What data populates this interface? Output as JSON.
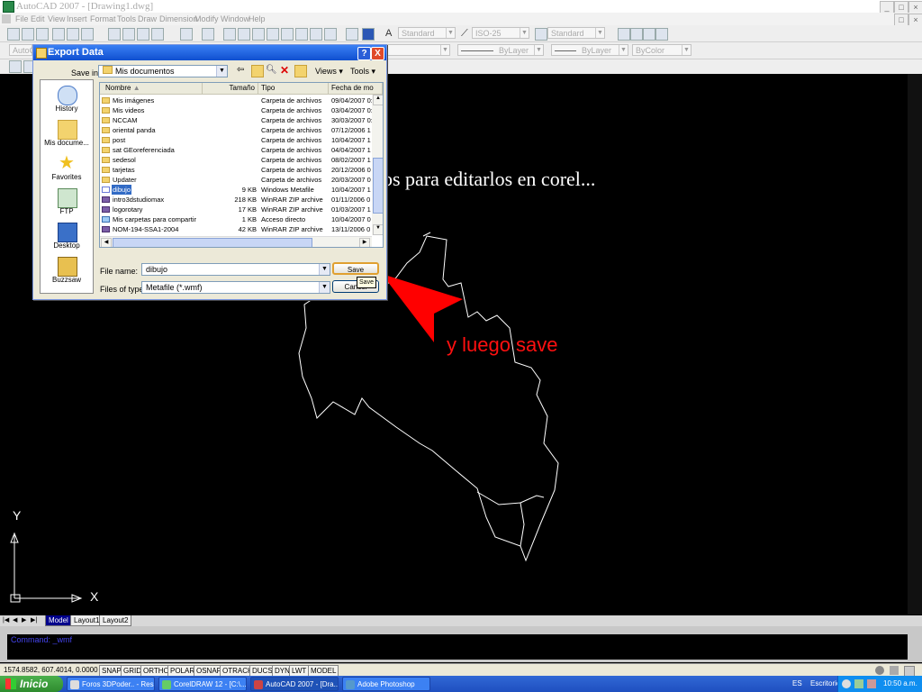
{
  "window": {
    "title": "AutoCAD 2007 - [Drawing1.dwg]"
  },
  "menu": [
    "File",
    "Edit",
    "View",
    "Insert",
    "Format",
    "Tools",
    "Draw",
    "Dimension",
    "Modify",
    "Window",
    "Help"
  ],
  "toolbar": {
    "text_style": "Standard",
    "dim_style": "ISO-25",
    "table_style": "Standard",
    "layer": "AutoC",
    "linetype": "ByLayer",
    "lineweight": "ByLayer",
    "color": "ByColor"
  },
  "dialog": {
    "title": "Export Data",
    "help_btn": "?",
    "close_btn": "X",
    "save_in_label": "Save in:",
    "save_in_value": "Mis documentos",
    "views_label": "Views",
    "tools_label": "Tools",
    "places": [
      "History",
      "Mis docume...",
      "Favorites",
      "FTP",
      "Desktop",
      "Buzzsaw"
    ],
    "columns": [
      "Nombre",
      "Tamaño",
      "Tipo",
      "Fecha de mo"
    ],
    "files": [
      {
        "name": "Mis imágenes",
        "size": "",
        "type": "Carpeta de archivos",
        "date": "09/04/2007 0:",
        "icon": "folder"
      },
      {
        "name": "Mis videos",
        "size": "",
        "type": "Carpeta de archivos",
        "date": "03/04/2007 0:",
        "icon": "folder"
      },
      {
        "name": "NCCAM",
        "size": "",
        "type": "Carpeta de archivos",
        "date": "30/03/2007 0:",
        "icon": "folder"
      },
      {
        "name": "oriental panda",
        "size": "",
        "type": "Carpeta de archivos",
        "date": "07/12/2006 1",
        "icon": "folder"
      },
      {
        "name": "post",
        "size": "",
        "type": "Carpeta de archivos",
        "date": "10/04/2007 1",
        "icon": "folder"
      },
      {
        "name": "sat GEoreferenciada",
        "size": "",
        "type": "Carpeta de archivos",
        "date": "04/04/2007 1",
        "icon": "folder"
      },
      {
        "name": "sedesol",
        "size": "",
        "type": "Carpeta de archivos",
        "date": "08/02/2007 1",
        "icon": "folder"
      },
      {
        "name": "tarjetas",
        "size": "",
        "type": "Carpeta de archivos",
        "date": "20/12/2006 0",
        "icon": "folder"
      },
      {
        "name": "Updater",
        "size": "",
        "type": "Carpeta de archivos",
        "date": "20/03/2007 0",
        "icon": "folder"
      },
      {
        "name": "dibujo",
        "size": "9 KB",
        "type": "Windows Metafile",
        "date": "10/04/2007 1",
        "icon": "doc",
        "selected": true
      },
      {
        "name": "intro3dstudiomax",
        "size": "218 KB",
        "type": "WinRAR ZIP archive",
        "date": "01/11/2006 0",
        "icon": "zip"
      },
      {
        "name": "logorotary",
        "size": "17 KB",
        "type": "WinRAR ZIP archive",
        "date": "01/03/2007 1",
        "icon": "zip"
      },
      {
        "name": "Mis carpetas para compartir",
        "size": "1 KB",
        "type": "Acceso directo",
        "date": "10/04/2007 0",
        "icon": "lnk"
      },
      {
        "name": "NOM-194-SSA1-2004",
        "size": "42 KB",
        "type": "WinRAR ZIP archive",
        "date": "13/11/2006 0",
        "icon": "zip"
      }
    ],
    "filename_label": "File name:",
    "filename_value": "dibujo",
    "filetype_label": "Files of type:",
    "filetype_value": "Metafile (*.wmf)",
    "save_button": "Save",
    "cancel_button": "Cancel",
    "tooltip": "Save"
  },
  "annotations": {
    "overlay_text": "os para editarlos en corel...",
    "red_note": "y luego save"
  },
  "ucs": {
    "x_label": "X",
    "y_label": "Y"
  },
  "layout_tabs": [
    "Model",
    "Layout1",
    "Layout2"
  ],
  "command": {
    "line1": "Command:  _wmf"
  },
  "status": {
    "coords": "1574.8582, 607.4014, 0.0000",
    "buttons": [
      "SNAP",
      "GRID",
      "ORTHO",
      "POLAR",
      "OSNAP",
      "OTRACK",
      "DUCS",
      "DYN",
      "LWT",
      "MODEL"
    ]
  },
  "taskbar": {
    "start": "Inicio",
    "tasks": [
      {
        "label": "Foros 3DPoder.. - Res...",
        "active": false
      },
      {
        "label": "CorelDRAW 12 - [C:\\...",
        "active": false
      },
      {
        "label": "AutoCAD 2007 - [Dra...",
        "active": true
      },
      {
        "label": "Adobe Photoshop",
        "active": false
      }
    ],
    "lang": "ES",
    "desk": "Escritorio",
    "clock": "10:50 a.m."
  }
}
